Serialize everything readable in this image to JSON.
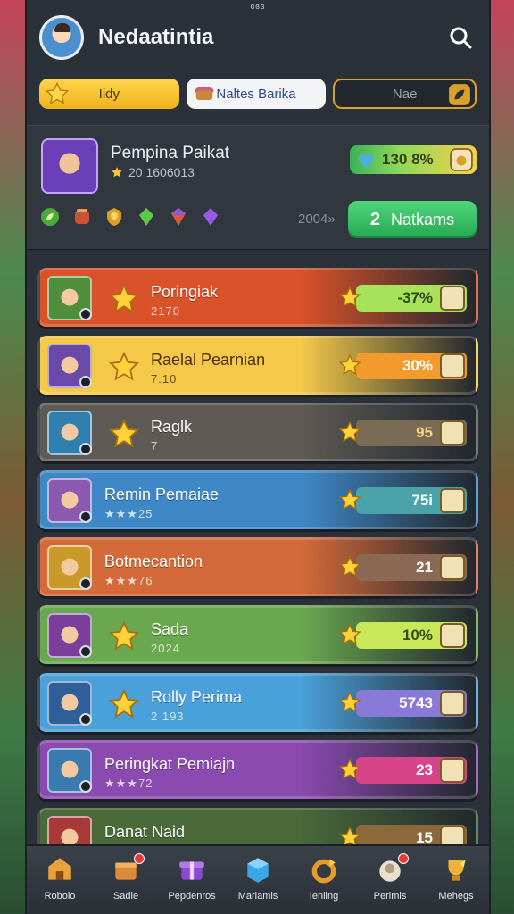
{
  "status_bar": {
    "text": "ɞɞɞ"
  },
  "header": {
    "title": "Nedaatintia"
  },
  "tabs": [
    {
      "label": "Iidy",
      "style": "yellow",
      "icon": "star-icon"
    },
    {
      "label": "Naltes Barika",
      "style": "white",
      "icon": "basket-icon"
    },
    {
      "label": "Nae",
      "style": "dark",
      "icon": "leaf-icon"
    }
  ],
  "profile": {
    "name": "Pempina Paikat",
    "meta": "20 1606013",
    "coins": "130 8%",
    "rank_readout": "2004»",
    "next_button": {
      "number": "2",
      "label": "Natkams"
    },
    "badges": [
      "green-leaf-badge",
      "red-pot-badge",
      "gold-shield-badge",
      "green-gem-badge",
      "purple-gem-badge",
      "violet-gem-badge"
    ]
  },
  "leaderboard": [
    {
      "title": "Poringiak",
      "sub": "2170",
      "score": "-37%",
      "bg": "#d9522a",
      "bar": "#a8e25a",
      "text_color": "#2d4a12",
      "avatar": "#4f8f3c",
      "layout": "star"
    },
    {
      "title": "Raelal Pearnian",
      "sub": "7.10",
      "score": "30%",
      "bg": "#f4c94a",
      "bar": "#f29a2b",
      "text_color": "#fff",
      "avatar": "#6a4aa8",
      "layout": "star",
      "dark_text": true
    },
    {
      "title": "Raglk",
      "sub": "7",
      "score": "95",
      "bg": "#5e5a55",
      "bar": "#7a6b55",
      "text_color": "#f4d58a",
      "avatar": "#2f7fb0",
      "layout": "star"
    },
    {
      "title": "Remin Pemaiae",
      "sub": "★★★25",
      "score": "75i",
      "bg": "#3f88c7",
      "bar": "#4aa3a8",
      "text_color": "#fff",
      "avatar": "#8a5ab0",
      "layout": "text"
    },
    {
      "title": "Botmecantion",
      "sub": "★★★76",
      "score": "21",
      "bg": "#d46a3a",
      "bar": "#8a6a55",
      "text_color": "#fff",
      "avatar": "#c99a2a",
      "layout": "text"
    },
    {
      "title": "Sada",
      "sub": "2024",
      "score": "10%",
      "bg": "#6aa84f",
      "bar": "#c8e85a",
      "text_color": "#3a4a10",
      "avatar": "#7a3f9a",
      "layout": "star"
    },
    {
      "title": "Rolly Perima",
      "sub": "2 193",
      "score": "5743",
      "bg": "#4aa0d8",
      "bar": "#8a7ad8",
      "text_color": "#fff",
      "avatar": "#2f5f9a",
      "layout": "star"
    },
    {
      "title": "Peringkat Pemiajn",
      "sub": "★★★72",
      "score": "23",
      "bg": "#8a4ab0",
      "bar": "#d8448a",
      "text_color": "#fff",
      "avatar": "#3a7ab0",
      "layout": "text"
    },
    {
      "title": "Danat Naid",
      "sub": "",
      "score": "15",
      "bg": "#4a6a3a",
      "bar": "#8a6a3a",
      "text_color": "#fff",
      "avatar": "#a83a3a",
      "layout": "text"
    }
  ],
  "bottom_nav": [
    {
      "label": "Robolo",
      "icon": "home-icon",
      "dot": false
    },
    {
      "label": "Sadie",
      "icon": "crate-icon",
      "dot": true
    },
    {
      "label": "Pepdenros",
      "icon": "gift-icon",
      "dot": false
    },
    {
      "label": "Mariamis",
      "icon": "cube-icon",
      "dot": false
    },
    {
      "label": "Ienling",
      "icon": "refresh-icon",
      "dot": false
    },
    {
      "label": "Perimis",
      "icon": "profile-icon",
      "dot": true
    },
    {
      "label": "Mehegs",
      "icon": "trophy-icon",
      "dot": false
    }
  ]
}
